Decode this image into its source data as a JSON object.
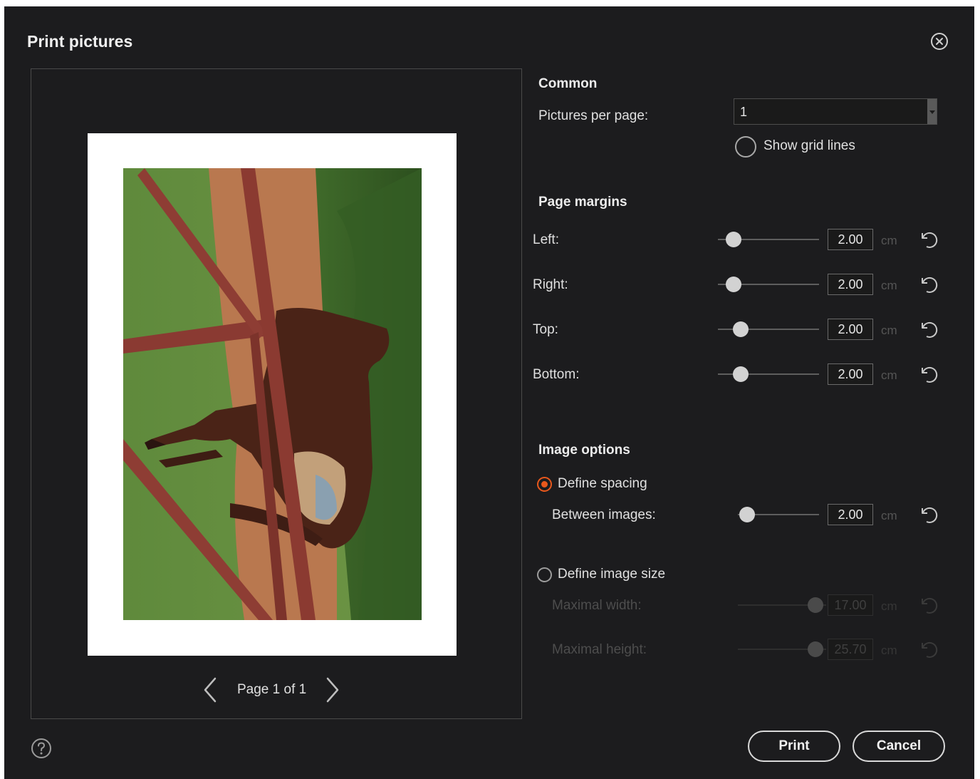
{
  "dialog": {
    "title": "Print pictures"
  },
  "preview": {
    "page_label": "Page 1 of 1"
  },
  "common": {
    "heading": "Common",
    "pictures_per_page_label": "Pictures per page:",
    "pictures_per_page_value": "1",
    "show_grid_lines_label": "Show grid lines",
    "show_grid_lines_checked": false
  },
  "page_margins": {
    "heading": "Page margins",
    "unit": "cm",
    "rows": [
      {
        "label": "Left:",
        "value": "2.00"
      },
      {
        "label": "Right:",
        "value": "2.00"
      },
      {
        "label": "Top:",
        "value": "2.00"
      },
      {
        "label": "Bottom:",
        "value": "2.00"
      }
    ]
  },
  "image_options": {
    "heading": "Image options",
    "define_spacing_label": "Define spacing",
    "define_spacing_selected": true,
    "between_images_label": "Between images:",
    "between_images_value": "2.00",
    "define_image_size_label": "Define image size",
    "define_image_size_selected": false,
    "maximal_width_label": "Maximal width:",
    "maximal_width_value": "17.00",
    "maximal_height_label": "Maximal height:",
    "maximal_height_value": "25.70",
    "unit": "cm"
  },
  "buttons": {
    "print": "Print",
    "cancel": "Cancel"
  },
  "colors": {
    "background": "#1c1c1e",
    "accent_radio": "#e8581c",
    "text": "#e6e6e6",
    "disabled": "#4d4d4d"
  },
  "icons": {
    "close": "close-circle-icon",
    "help": "question-circle-icon",
    "reset": "undo-icon",
    "prev": "chevron-left-icon",
    "next": "chevron-right-icon"
  }
}
